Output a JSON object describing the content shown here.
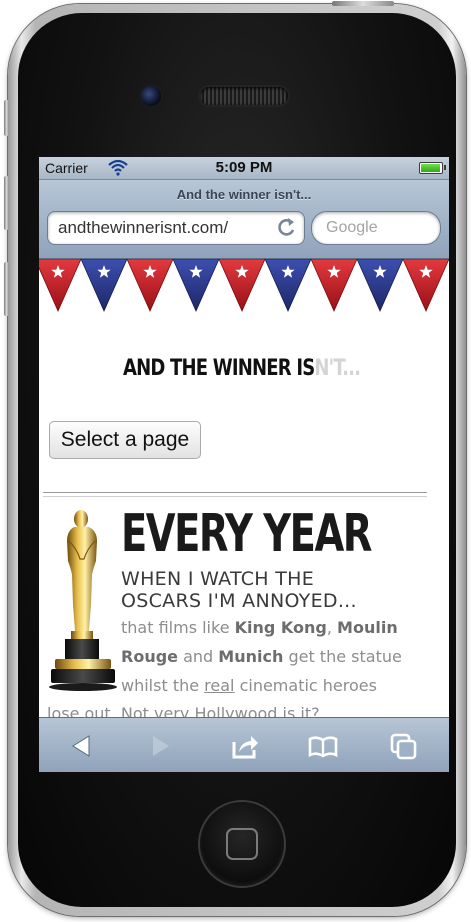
{
  "status_bar": {
    "carrier": "Carrier",
    "time": "5:09 PM",
    "battery_level": 1.0
  },
  "navbar": {
    "page_title": "And the winner isn't...",
    "url": "andthewinnerisnt.com/",
    "search_placeholder": "Google"
  },
  "page": {
    "site_title_dark": "AND THE WINNER IS",
    "site_title_light": "N'T...",
    "select_label": "Select a page",
    "headline": "EVERY YEAR",
    "subhead_line1": "WHEN I WATCH THE",
    "subhead_line2": "OSCARS I'M ANNOYED...",
    "body": {
      "l1_a": "that films like ",
      "l1_b": "King Kong",
      "l1_c": ", ",
      "l1_d": "Moulin",
      "l2_a": "Rouge",
      "l2_b": " and ",
      "l2_c": "Munich",
      "l2_d": " get the statue",
      "l3_a": "whilst the ",
      "l3_b": "real",
      "l3_c": " cinematic heroes",
      "l4": "lose out. Not very Hollywood is it?"
    }
  },
  "toolbar": {
    "back_icon": "back-arrow-icon",
    "forward_icon": "forward-arrow-icon",
    "share_icon": "share-icon",
    "bookmarks_icon": "bookmarks-book-icon",
    "tabs_icon": "tabs-pages-icon"
  },
  "colors": {
    "pennant_red": "#c8202a",
    "pennant_blue": "#2b3a8f",
    "bar_blue": "#9fb1c6"
  }
}
